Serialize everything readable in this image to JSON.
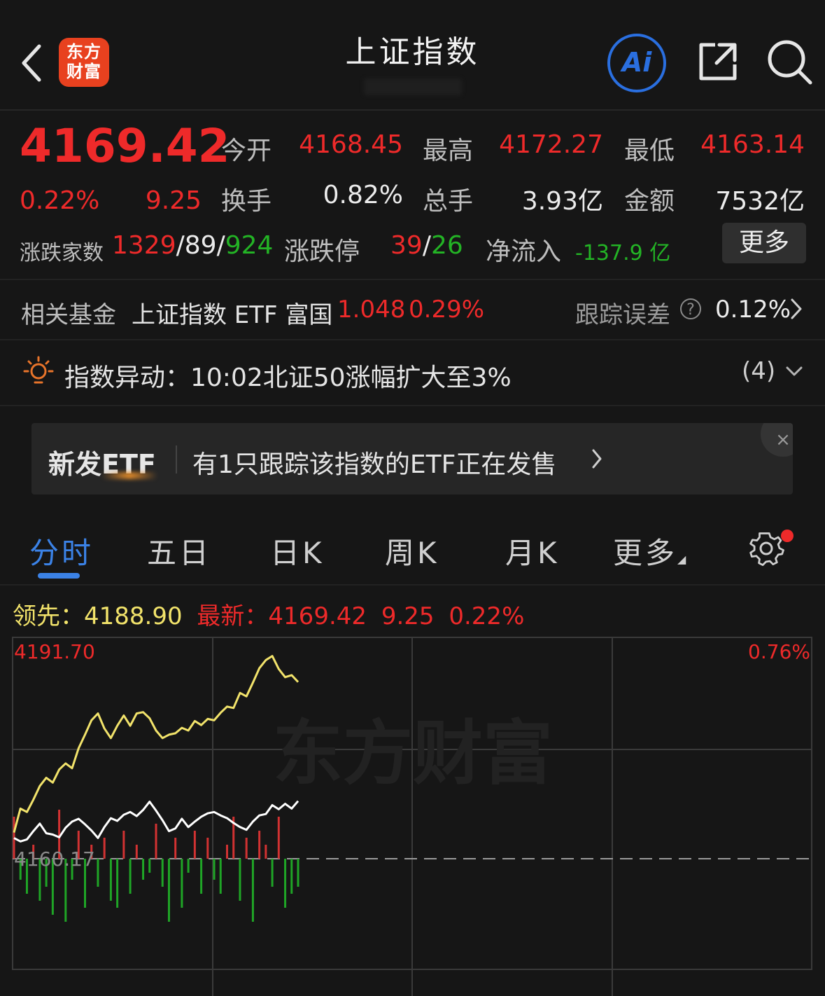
{
  "header": {
    "logo_text": "东方财富",
    "title": "上证指数",
    "ai_label": "Ai"
  },
  "quote": {
    "price": "4169.42",
    "change_pct": "0.22%",
    "change": "9.25",
    "stats": [
      {
        "label": "今开",
        "value": "4168.45",
        "color": "red"
      },
      {
        "label": "最高",
        "value": "4172.27",
        "color": "red"
      },
      {
        "label": "最低",
        "value": "4163.14",
        "color": "red"
      },
      {
        "label": "换手",
        "value": "0.82%",
        "color": "white"
      },
      {
        "label": "总手",
        "value": "3.93亿",
        "color": "white"
      },
      {
        "label": "金额",
        "value": "7532亿",
        "color": "white"
      }
    ],
    "breadth_label": "涨跌家数",
    "breadth_up": "1329",
    "breadth_flat": "89",
    "breadth_down": "924",
    "limit_label": "涨跌停",
    "limit_up": "39",
    "limit_down": "26",
    "netflow_label": "净流入",
    "netflow_value": "-137.9 亿",
    "more_label": "更多"
  },
  "fund": {
    "label": "相关基金",
    "name": "上证指数 ETF 富国",
    "price": "1.048",
    "pct": "0.29%",
    "track_label": "跟踪误差",
    "track_value": "0.12%"
  },
  "alert": {
    "text": "指数异动：10:02北证50涨幅扩大至3%",
    "count": "(4)"
  },
  "etf_banner": {
    "tag": "新发ETF",
    "text": "有1只跟踪该指数的ETF正在发售",
    "close": "×"
  },
  "tabs": [
    {
      "label": "分时",
      "active": true
    },
    {
      "label": "五日"
    },
    {
      "label": "日K"
    },
    {
      "label": "周K"
    },
    {
      "label": "月K"
    },
    {
      "label": "更多"
    }
  ],
  "info_line": {
    "lead_label": "领先：",
    "lead_value": "4188.90",
    "latest_label": "最新：",
    "latest_value": "4169.42",
    "change": "9.25",
    "pct": "0.22%"
  },
  "chart_data": {
    "type": "line",
    "y_top_label": "4191.70",
    "y_base_label": "4160.17",
    "right_top_label": "0.76%",
    "watermark": "东方财富",
    "ylim": [
      4160.17,
      4191.7
    ],
    "colors": {
      "lead": "#f2e36b",
      "price": "#ffffff",
      "up_bar": "#d23232",
      "down_bar": "#1fa526",
      "grid": "#3a3a3a"
    },
    "series": [
      {
        "values": [
          4164.0,
          4167.5,
          4167.0,
          4168.8,
          4170.8,
          4172.0,
          4171.3,
          4173.2,
          4174.1,
          4173.4,
          4176.3,
          4178.3,
          4180.4,
          4181.4,
          4179.2,
          4177.8,
          4179.6,
          4181.1,
          4179.6,
          4181.4,
          4181.6,
          4180.7,
          4178.9,
          4177.8,
          4178.3,
          4178.5,
          4179.3,
          4178.9,
          4180.3,
          4179.7,
          4180.6,
          4180.4,
          4181.5,
          4182.4,
          4182.2,
          4184.4,
          4183.9,
          4185.9,
          4188.0,
          4189.2,
          4189.8,
          4187.9,
          4186.7,
          4187.0,
          4186.0
        ]
      },
      {
        "values": [
          4163.2,
          4162.7,
          4163.0,
          4164.2,
          4165.3,
          4163.9,
          4163.7,
          4163.3,
          4164.7,
          4165.6,
          4166.0,
          4165.2,
          4164.3,
          4163.2,
          4164.8,
          4166.1,
          4165.7,
          4166.6,
          4167.0,
          4166.4,
          4167.3,
          4168.5,
          4167.2,
          4165.8,
          4164.2,
          4164.6,
          4166.0,
          4164.8,
          4165.6,
          4166.3,
          4166.8,
          4167.0,
          4166.5,
          4166.1,
          4165.4,
          4164.8,
          4164.4,
          4165.6,
          4166.5,
          4166.7,
          4168.0,
          4167.4,
          4168.2,
          4167.5,
          4168.6
        ]
      }
    ],
    "volume_bars": [
      6,
      -3,
      -5,
      2,
      -6,
      -4,
      -8,
      7,
      -9,
      -3,
      4,
      -7,
      2,
      -4,
      3,
      -6,
      -7,
      4,
      -5,
      2,
      -3,
      -2,
      5,
      -4,
      -9,
      3,
      -7,
      -2,
      4,
      -5,
      3,
      -3,
      -5,
      2,
      6,
      -6,
      3,
      -9,
      4,
      2,
      -4,
      6,
      -7,
      -5,
      -4
    ]
  }
}
